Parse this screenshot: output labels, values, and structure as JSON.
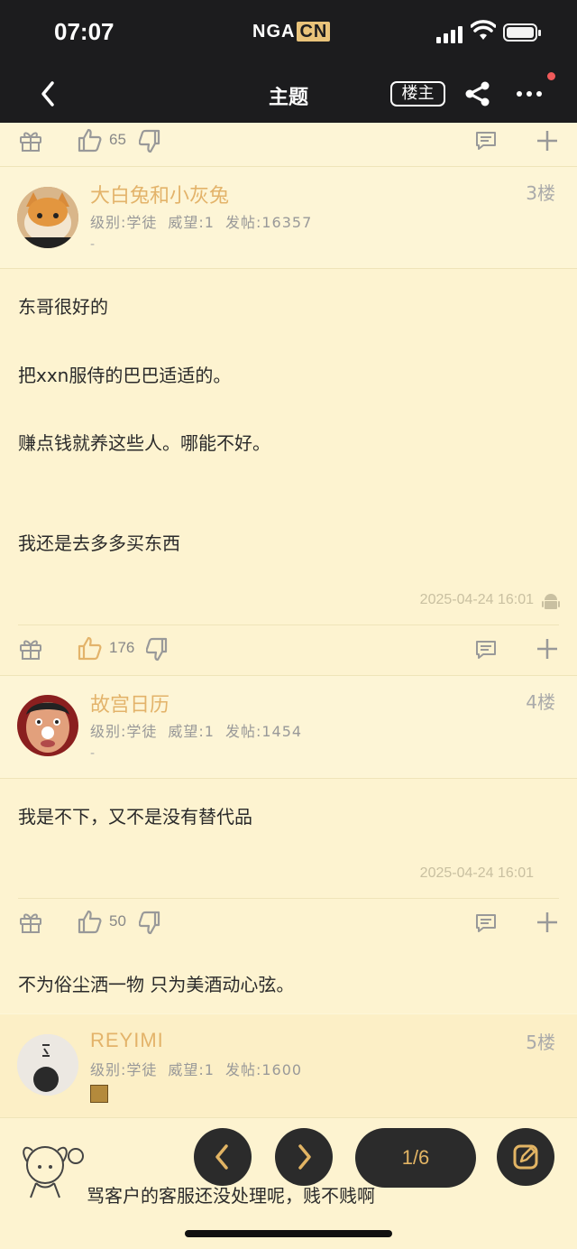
{
  "status": {
    "time": "07:07",
    "brand": "NGA",
    "brand_cn": "CN"
  },
  "nav": {
    "title": "主题",
    "louzhu_label": "楼主"
  },
  "top_actions": {
    "like_count": "65"
  },
  "posts": [
    {
      "name": "大白兔和小灰兔",
      "floor": "3楼",
      "meta": {
        "level": "级别:学徒",
        "rep": "威望:1",
        "count": "发帖:16357"
      },
      "dash": "-",
      "lines": [
        "东哥很好的",
        "把xxn服侍的巴巴适适的。",
        "赚点钱就养这些人。哪能不好。",
        "我还是去多多买东西"
      ],
      "time": "2025-04-24 16:01",
      "like_count": "176"
    },
    {
      "name": "故宫日历",
      "floor": "4楼",
      "meta": {
        "level": "级别:学徒",
        "rep": "威望:1",
        "count": "发帖:1454"
      },
      "dash": "-",
      "lines": [
        "我是不下，又不是没有替代品"
      ],
      "time": "2025-04-24 16:01",
      "like_count": "50",
      "signature": "不为俗尘洒一物 只为美酒动心弦。"
    },
    {
      "name": "REYIMI",
      "floor": "5楼",
      "meta": {
        "level": "级别:学徒",
        "rep": "威望:1",
        "count": "发帖:1600"
      },
      "lines": [
        "骂客户的客服还没处理呢，贱不贱啊"
      ]
    }
  ],
  "pager": {
    "label": "1/6"
  },
  "colors": {
    "accent": "#e3b36a",
    "background": "#fdf5d6",
    "topbar": "#1c1c1e"
  }
}
